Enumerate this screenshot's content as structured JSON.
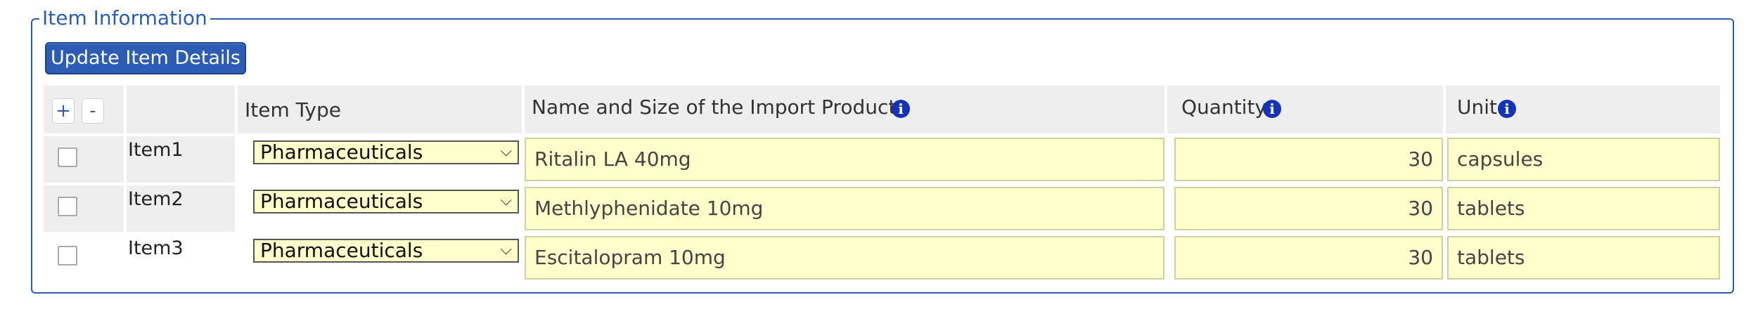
{
  "section": {
    "legend": "Item Information",
    "update_button": "Update Item Details"
  },
  "table": {
    "add_label": "+",
    "remove_label": "-",
    "headers": {
      "item_type": "Item Type",
      "name_size": "Name and Size of the Import Products",
      "quantity": "Quantity",
      "unit": "Unit"
    },
    "rows": [
      {
        "label": "Item1",
        "type": "Pharmaceuticals",
        "name": "Ritalin LA 40mg",
        "quantity": "30",
        "unit": "capsules"
      },
      {
        "label": "Item2",
        "type": "Pharmaceuticals",
        "name": "Methlyphenidate 10mg",
        "quantity": "30",
        "unit": "tablets"
      },
      {
        "label": "Item3",
        "type": "Pharmaceuticals",
        "name": "Escitalopram 10mg",
        "quantity": "30",
        "unit": "tablets"
      }
    ]
  },
  "icons": {
    "info": "i",
    "chevron": "⌵"
  },
  "colors": {
    "accent": "#2c5cb4",
    "field_bg": "#ffffcc",
    "info_icon": "#1433b8"
  }
}
